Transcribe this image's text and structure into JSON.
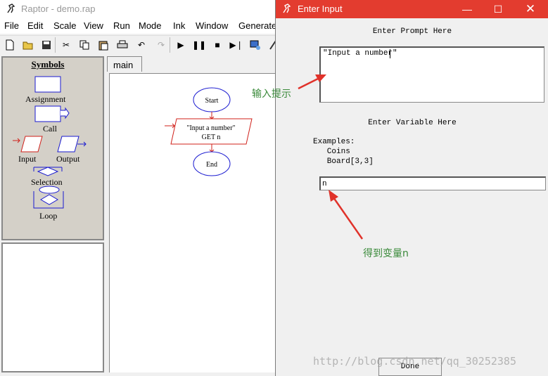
{
  "main_window": {
    "title": "Raptor - demo.rap",
    "menu": [
      "File",
      "Edit",
      "Scale",
      "View",
      "Run",
      "Mode",
      "Ink",
      "Window",
      "Generate"
    ],
    "toolbar_icons": [
      "new-icon",
      "open-icon",
      "save-icon",
      "cut-icon",
      "copy-icon",
      "paste-icon",
      "print-icon",
      "undo-icon",
      "redo-icon",
      "play-icon",
      "pause-icon",
      "stop-icon",
      "step-icon",
      "test-icon",
      "pen-icon"
    ]
  },
  "symbols": {
    "title": "Symbols",
    "assignment": "Assignment",
    "call": "Call",
    "input": "Input",
    "output": "Output",
    "selection": "Selection",
    "loop": "Loop"
  },
  "tab": {
    "label": "main"
  },
  "flowchart": {
    "start": "Start",
    "input_line1": "\"Input a number\"",
    "input_line2": "GET n",
    "end": "End"
  },
  "dialog": {
    "title": "Enter Input",
    "prompt_label": "Enter Prompt Here",
    "prompt_value": "\"Input a number\"",
    "variable_label": "Enter Variable Here",
    "examples_header": "Examples:",
    "examples": [
      "   Coins",
      "   Board[3,3]"
    ],
    "variable_value": "n",
    "done_label": "Done"
  },
  "annotations": {
    "prompt_note": "输入提示",
    "variable_note": "得到变量n"
  },
  "watermark": "http://blog.csdn.net/qq_30252385",
  "colors": {
    "dialog_title_bg": "#e33c2f",
    "flow_blue": "#1a1ad0",
    "flow_red": "#d0201a",
    "arrow_red": "#e0322a",
    "annotation_green": "#3a8a3a"
  }
}
